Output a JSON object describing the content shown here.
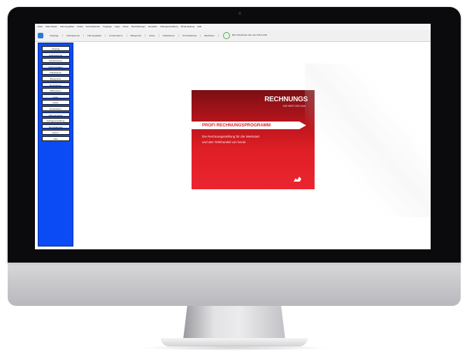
{
  "menubar": {
    "items": [
      "Datei",
      "Stammdaten",
      "Fahrzeugdaten",
      "Artikel",
      "Terminkalender",
      "Vorgänge",
      "Lager",
      "Kasse",
      "Buchhaltungen",
      "Hersteller",
      "Auftragsverwaltung",
      "SP-Einstellung",
      "Hilfe"
    ]
  },
  "toolbar": {
    "items": [
      "Vorgänge",
      "Auftragssuche",
      "Fahrzeugdaten",
      "Kundenstamm",
      "Belegsuche",
      "Kasse",
      "Artikelstamm",
      "Terminkalender",
      "Bearbeiten"
    ],
    "extra": "Beim Bearbeiten über die Online Hilfe"
  },
  "sidebar": {
    "buttons": [
      "Vorgang",
      "Auftragssuche",
      "Kundenstamm",
      "Fahrzeugdaten",
      "Artikelstamm",
      "Belegsuche",
      "Buchhaltung",
      "Mahnwesen",
      "Lager",
      "Kasse",
      "Reparaturen",
      "Wareneingang",
      "Auftragsverwaltung",
      "Terminkalender",
      "Export",
      "Hilfe"
    ]
  },
  "splash": {
    "brand": "RECHNUNGS",
    "tagline": "DER WERT DER ZAHL",
    "title": "PROFI RECHNUNGSPROGRAMM",
    "subtitle_line1": "Die Rechnungsstellung für die Werkstatt",
    "subtitle_line2": "und den Teilehandel von heute",
    "accent_color": "#e01e25"
  }
}
